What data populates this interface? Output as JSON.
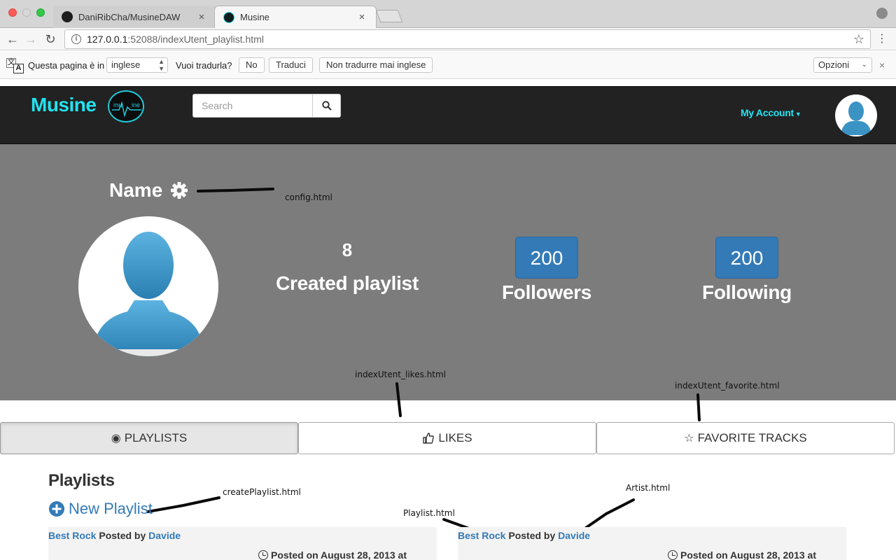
{
  "browser": {
    "tabs": [
      {
        "title": "DaniRibCha/MusineDAW",
        "close": "×"
      },
      {
        "title": "Musine",
        "close": "×"
      }
    ],
    "url_host": "127.0.0.1",
    "url_path": ":52088/indexUtent_playlist.html"
  },
  "translate_bar": {
    "prompt": "Questa pagina è in",
    "language": "inglese",
    "question": "Vuoi tradurla?",
    "no_label": "No",
    "translate_label": "Traduci",
    "never_label": "Non tradurre mai inglese",
    "options_label": "Opzioni",
    "close": "×"
  },
  "navbar": {
    "brand": "Musine",
    "logo_text": "mu  ine",
    "search_placeholder": "Search",
    "account_label": "My Account",
    "brand_color": "#22e3f0"
  },
  "profile": {
    "name": "Name",
    "created_count": "8",
    "created_label": "Created playlist",
    "followers_count": "200",
    "followers_label": "Followers",
    "following_count": "200",
    "following_label": "Following",
    "badge_color": "#337ab7"
  },
  "tabs": {
    "playlists": "PLAYLISTS",
    "likes": "LIKES",
    "favorites": "FAVORITE TRACKS"
  },
  "playlists": {
    "title": "Playlists",
    "new_label": "New Playlist",
    "cards": [
      {
        "name": "Best Rock",
        "posted_by": "Posted by",
        "author": "Davide",
        "posted_on": "Posted on August 28, 2013 at"
      },
      {
        "name": "Best Rock",
        "posted_by": "Posted by",
        "author": "Davide",
        "posted_on": "Posted on August 28, 2013 at"
      }
    ]
  },
  "annotations": {
    "config": "config.html",
    "likes": "indexUtent_likes.html",
    "favorite": "indexUtent_favorite.html",
    "create_playlist": "createPlaylist.html",
    "playlist": "Playlist.html",
    "artist": "Artist.html"
  }
}
